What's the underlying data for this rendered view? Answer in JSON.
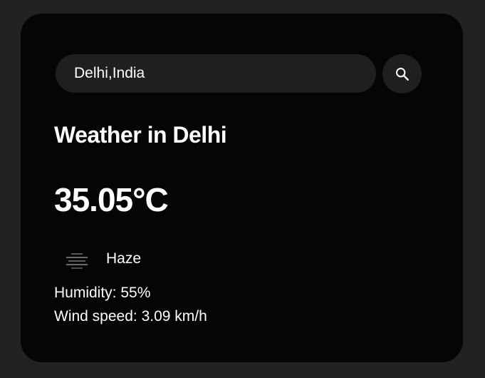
{
  "search": {
    "value": "Delhi,India",
    "icon": "search-icon"
  },
  "weather": {
    "title": "Weather in Delhi",
    "temperature": "35.05°C",
    "condition": "Haze",
    "condition_icon": "haze-icon",
    "humidity": "Humidity: 55%",
    "wind": "Wind speed: 3.09 km/h"
  },
  "colors": {
    "page_background": "#222222",
    "card_background": "#050505",
    "input_background": "#1f1f1f",
    "text": "#ffffff"
  }
}
